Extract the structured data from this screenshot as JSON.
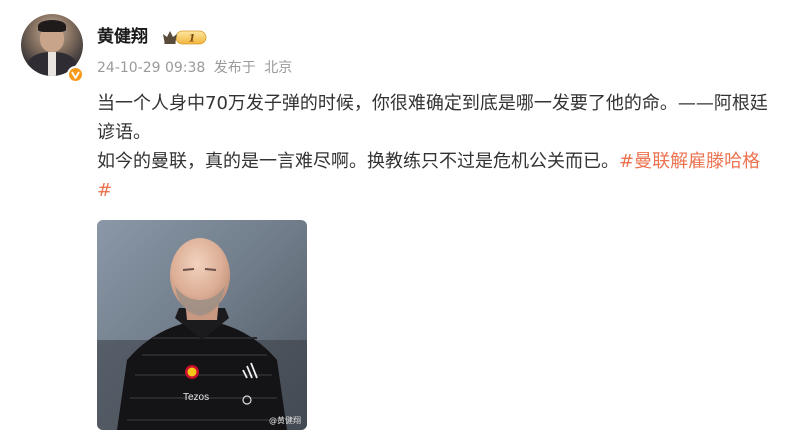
{
  "post": {
    "author": "黄健翔",
    "vip_level": "1",
    "time": "24-10-29 09:38",
    "source_prefix": "发布于",
    "location": "北京",
    "text_line1": "当一个人身中70万发子弹的时候，你很难确定到底是哪一发要了他的命。——阿根廷谚语。",
    "text_line2": "如今的曼联，真的是一言难尽啊。换教练只不过是危机公关而已。",
    "hashtag": "#曼联解雇滕哈格#",
    "image": {
      "watermark": "@黄健翔"
    }
  },
  "colors": {
    "hashtag": "#eb7350",
    "verified_badge": "#f79a1a",
    "meta_text": "#9a9a9a"
  },
  "icons": {
    "verified": "verified-v-icon",
    "vip": "crown-vip-icon"
  }
}
